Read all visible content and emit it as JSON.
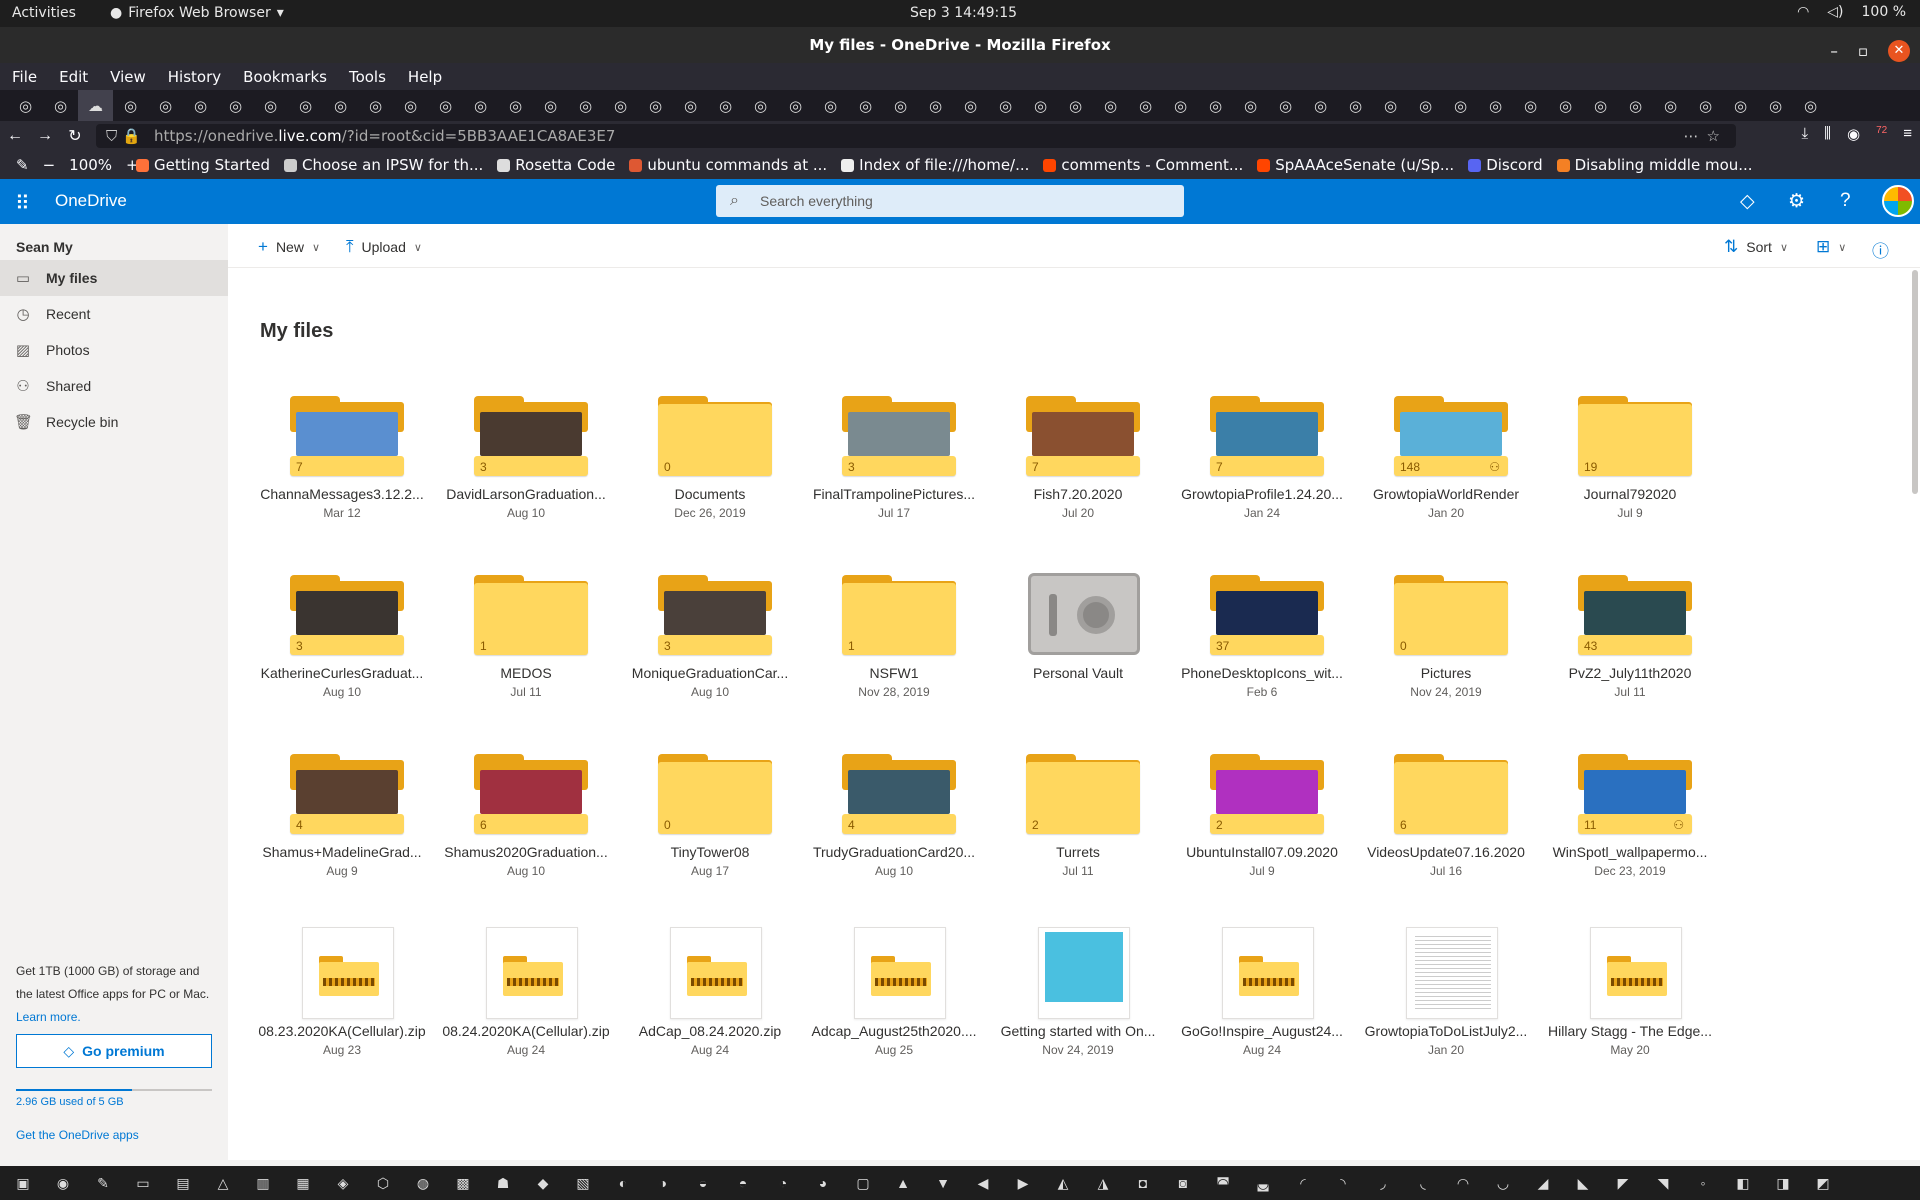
{
  "topbar": {
    "activities": "Activities",
    "app": "Firefox Web Browser",
    "clock": "Sep 3  14:49:15",
    "battery": "100 %"
  },
  "window": {
    "title": "My files - OneDrive - Mozilla Firefox"
  },
  "menu": [
    "File",
    "Edit",
    "View",
    "History",
    "Bookmarks",
    "Tools",
    "Help"
  ],
  "url": {
    "domain_prefix": "https://onedrive.",
    "domain": "live.com",
    "path": "/?id=root&cid=5BB3AAE1CA8AE3E7",
    "badge": "72"
  },
  "bookmarks": {
    "zoom": "100%",
    "items": [
      {
        "label": "Getting Started",
        "color": "#ff7139"
      },
      {
        "label": "Choose an IPSW for th...",
        "color": "#cccccc"
      },
      {
        "label": "Rosetta Code",
        "color": "#dddddd"
      },
      {
        "label": "ubuntu commands at ...",
        "color": "#de5833"
      },
      {
        "label": "Index of file:///home/...",
        "color": "#eeeeee"
      },
      {
        "label": "comments - Comment...",
        "color": "#ff4500"
      },
      {
        "label": "SpAAAceSenate (u/Sp...",
        "color": "#ff4500"
      },
      {
        "label": "Discord",
        "color": "#5865f2"
      },
      {
        "label": "Disabling middle mou...",
        "color": "#f48024"
      }
    ]
  },
  "onedrive": {
    "brand": "OneDrive",
    "search_placeholder": "Search everything",
    "user": "Sean My",
    "nav": [
      {
        "label": "My files",
        "icon": "folder-icon",
        "glyph": "▭"
      },
      {
        "label": "Recent",
        "icon": "clock-icon",
        "glyph": "◷"
      },
      {
        "label": "Photos",
        "icon": "photo-icon",
        "glyph": "▨"
      },
      {
        "label": "Shared",
        "icon": "people-icon",
        "glyph": "⚇"
      },
      {
        "label": "Recycle bin",
        "icon": "trash-icon",
        "glyph": "🗑"
      }
    ],
    "promo": {
      "text1": "Get 1TB (1000 GB) of storage and",
      "text2": "the latest Office apps for PC or Mac.",
      "learn": "Learn more.",
      "premium": "Go premium",
      "quota": "2.96 GB used of 5 GB",
      "quota_fraction": 0.592,
      "apps": "Get the OneDrive apps"
    },
    "cmd": {
      "new": "New",
      "upload": "Upload",
      "sort": "Sort"
    },
    "heading": "My files"
  },
  "files": [
    {
      "name": "ChannaMessages3.12.2...",
      "date": "Mar 12",
      "count": "7",
      "type": "folder",
      "thumb": "#5a8fd0"
    },
    {
      "name": "DavidLarsonGraduation...",
      "date": "Aug 10",
      "count": "3",
      "type": "folder",
      "thumb": "#4a3a30"
    },
    {
      "name": "Documents",
      "date": "Dec 26, 2019",
      "count": "0",
      "type": "folder",
      "thumb": ""
    },
    {
      "name": "FinalTrampolinePictures...",
      "date": "Jul 17",
      "count": "3",
      "type": "folder",
      "thumb": "#7a8a90"
    },
    {
      "name": "Fish7.20.2020",
      "date": "Jul 20",
      "count": "7",
      "type": "folder",
      "thumb": "#8a5030"
    },
    {
      "name": "GrowtopiaProfile1.24.20...",
      "date": "Jan 24",
      "count": "7",
      "type": "folder",
      "thumb": "#3b7fa8"
    },
    {
      "name": "GrowtopiaWorldRender",
      "date": "Jan 20",
      "count": "148",
      "type": "folder",
      "thumb": "#5ab0d8",
      "shared": true
    },
    {
      "name": "Journal792020",
      "date": "Jul 9",
      "count": "19",
      "type": "folder",
      "thumb": ""
    },
    {
      "name": "KatherineCurlesGraduat...",
      "date": "Aug 10",
      "count": "3",
      "type": "folder",
      "thumb": "#3a3430"
    },
    {
      "name": "MEDOS",
      "date": "Jul 11",
      "count": "1",
      "type": "folder",
      "thumb": ""
    },
    {
      "name": "MoniqueGraduationCar...",
      "date": "Aug 10",
      "count": "3",
      "type": "folder",
      "thumb": "#4a403a"
    },
    {
      "name": "NSFW1",
      "date": "Nov 28, 2019",
      "count": "1",
      "type": "folder",
      "thumb": ""
    },
    {
      "name": "Personal Vault",
      "date": "",
      "count": "",
      "type": "vault",
      "thumb": ""
    },
    {
      "name": "PhoneDesktopIcons_wit...",
      "date": "Feb 6",
      "count": "37",
      "type": "folder",
      "thumb": "#1a2a50"
    },
    {
      "name": "Pictures",
      "date": "Nov 24, 2019",
      "count": "0",
      "type": "folder",
      "thumb": ""
    },
    {
      "name": "PvZ2_July11th2020",
      "date": "Jul 11",
      "count": "43",
      "type": "folder",
      "thumb": "#2a4a50"
    },
    {
      "name": "Shamus+MadelineGrad...",
      "date": "Aug 9",
      "count": "4",
      "type": "folder",
      "thumb": "#5a4030"
    },
    {
      "name": "Shamus2020Graduation...",
      "date": "Aug 10",
      "count": "6",
      "type": "folder",
      "thumb": "#a03040"
    },
    {
      "name": "TinyTower08",
      "date": "Aug 17",
      "count": "0",
      "type": "folder",
      "thumb": ""
    },
    {
      "name": "TrudyGraduationCard20...",
      "date": "Aug 10",
      "count": "4",
      "type": "folder",
      "thumb": "#3a5a6a"
    },
    {
      "name": "Turrets",
      "date": "Jul 11",
      "count": "2",
      "type": "folder",
      "thumb": ""
    },
    {
      "name": "UbuntuInstall07.09.2020",
      "date": "Jul 9",
      "count": "2",
      "type": "folder",
      "thumb": "#b030c0"
    },
    {
      "name": "VideosUpdate07.16.2020",
      "date": "Jul 16",
      "count": "6",
      "type": "folder",
      "thumb": ""
    },
    {
      "name": "WinSpotl_wallpapermo...",
      "date": "Dec 23, 2019",
      "count": "11",
      "type": "folder",
      "thumb": "#2a70c0",
      "shared": true
    },
    {
      "name": "08.23.2020KA(Cellular).zip",
      "date": "Aug 23",
      "count": "",
      "type": "zip",
      "thumb": ""
    },
    {
      "name": "08.24.2020KA(Cellular).zip",
      "date": "Aug 24",
      "count": "",
      "type": "zip",
      "thumb": ""
    },
    {
      "name": "AdCap_08.24.2020.zip",
      "date": "Aug 24",
      "count": "",
      "type": "zip",
      "thumb": ""
    },
    {
      "name": "Adcap_August25th2020....",
      "date": "Aug 25",
      "count": "",
      "type": "zip",
      "thumb": ""
    },
    {
      "name": "Getting started with On...",
      "date": "Nov 24, 2019",
      "count": "",
      "type": "pdf",
      "thumb": "#4ac0e0"
    },
    {
      "name": "GoGo!Inspire_August24...",
      "date": "Aug 24",
      "count": "",
      "type": "zip",
      "thumb": ""
    },
    {
      "name": "GrowtopiaToDoListJuly2...",
      "date": "Jan 20",
      "count": "",
      "type": "doc",
      "thumb": ""
    },
    {
      "name": "Hillary Stagg - The Edge...",
      "date": "May 20",
      "count": "",
      "type": "zip",
      "thumb": "",
      "shared": true
    }
  ]
}
